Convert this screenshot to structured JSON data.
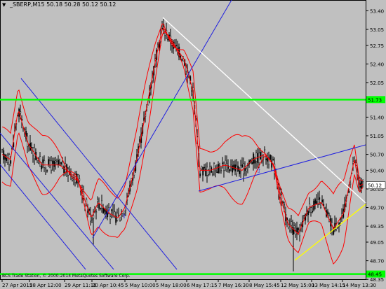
{
  "header": {
    "arrow": "▼",
    "symbol": "_SBERP,M15",
    "ohlc": "50.18 50.28 50.12 50.12"
  },
  "footer": "BCS Trade Station, © 2000-2014 MetaQuotes Software Corp.",
  "chart_data": {
    "type": "candlestick",
    "y_ticks": [
      "53.40",
      "53.05",
      "52.75",
      "52.40",
      "52.05",
      "51.75",
      "51.40",
      "51.05",
      "50.70",
      "50.40",
      "50.05",
      "49.70",
      "49.35",
      "49.05",
      "48.70",
      "48.35"
    ],
    "x_ticks": [
      "27 Apr 2015",
      "28 Apr 12:00",
      "29 Apr 11:15",
      "30 Apr 10:45",
      "5 May 10:00",
      "5 May 18:00",
      "6 May 17:15",
      "7 May 16:30",
      "8 May 15:45",
      "12 May 15:00",
      "13 May 14:15",
      "14 May 13:30"
    ],
    "current_price": "50.12",
    "levels": [
      "51.73",
      "48.45"
    ],
    "ylim": [
      48.3,
      53.55
    ],
    "colors": {
      "background": "#c0c0c0",
      "candles": "#000000",
      "bollinger": "#ff0000",
      "trend_blue": "#1f1fdf",
      "trend_white": "#ffffff",
      "trend_yellow": "#ffff00",
      "level_green": "#00ff00",
      "price_label_bg": "#ffffff"
    }
  }
}
